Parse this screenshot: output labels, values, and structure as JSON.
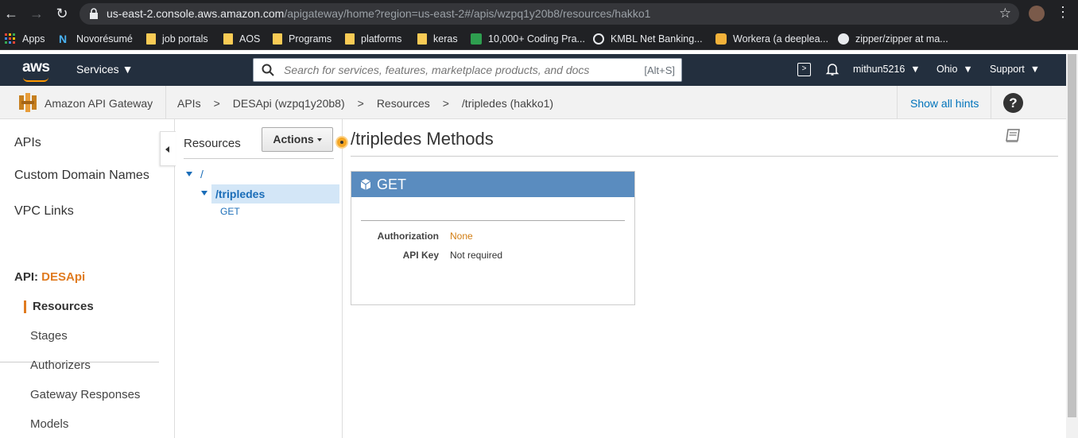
{
  "browser": {
    "url_host": "us-east-2.console.aws.amazon.com",
    "url_path": "/apigateway/home?region=us-east-2#/apis/wzpq1y20b8/resources/hakko1",
    "bookmarks": [
      "Apps",
      "Novorésumé",
      "job portals",
      "AOS",
      "Programs",
      "platforms",
      "keras",
      "10,000+ Coding Pra...",
      "KMBL Net Banking...",
      "Workera (a deeplea...",
      "zipper/zipper at ma..."
    ]
  },
  "aws_bar": {
    "logo": "aws",
    "services_label": "Services",
    "search_placeholder": "Search for services, features, marketplace products, and docs",
    "search_shortcut": "[Alt+S]",
    "user": "mithun5216",
    "region": "Ohio",
    "support": "Support"
  },
  "breadcrumb": {
    "service_name": "Amazon API Gateway",
    "items": [
      "APIs",
      ">",
      "DESApi (wzpq1y20b8)",
      ">",
      "Resources",
      ">",
      "/tripledes (hakko1)"
    ],
    "hints_label": "Show all hints",
    "help_label": "?"
  },
  "sidebar": {
    "main_items": [
      "APIs",
      "Custom Domain Names",
      "VPC Links"
    ],
    "api_prefix": "API:",
    "api_name": "DESApi",
    "sub_items": [
      "Resources",
      "Stages",
      "Authorizers",
      "Gateway Responses",
      "Models"
    ]
  },
  "resources_panel": {
    "title": "Resources",
    "actions_label": "Actions",
    "tree_root": "/",
    "tree_resource": "/tripledes",
    "tree_method": "GET"
  },
  "main": {
    "title": "/tripledes Methods",
    "method": {
      "name": "GET",
      "authorization_label": "Authorization",
      "authorization_value": "None",
      "api_key_label": "API Key",
      "api_key_value": "Not required"
    }
  },
  "colors": {
    "aws_bar": "#232f3e",
    "accent_orange": "#e07b20",
    "method_header": "#5a8cbf",
    "link_blue": "#0073bb"
  }
}
